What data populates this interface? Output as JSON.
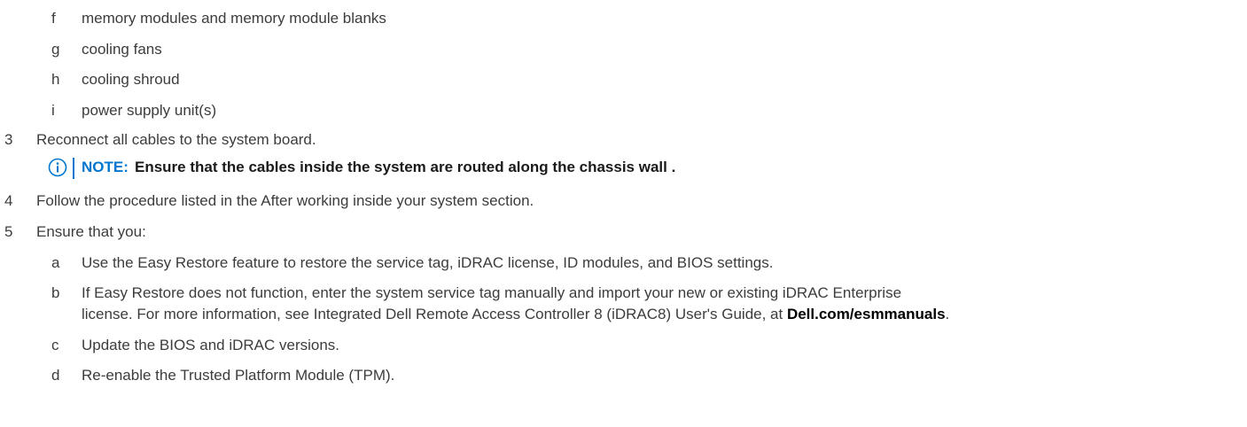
{
  "steps_sub_top": [
    {
      "marker": "f",
      "text": "memory modules and memory module blanks"
    },
    {
      "marker": "g",
      "text": "cooling fans"
    },
    {
      "marker": "h",
      "text": "cooling shroud"
    },
    {
      "marker": "i",
      "text": "power supply unit(s)"
    }
  ],
  "step3": {
    "marker": "3",
    "text": "Reconnect all cables to the system board."
  },
  "note": {
    "label": "NOTE:",
    "text": "Ensure that the cables inside the system are routed along the chassis wall .",
    "icon": "info-circle-icon"
  },
  "step4": {
    "marker": "4",
    "text": "Follow the procedure listed in the After working inside your system section."
  },
  "step5": {
    "marker": "5",
    "text": "Ensure that you:"
  },
  "steps_sub_bottom": {
    "a": {
      "marker": "a",
      "text": "Use the Easy Restore feature to restore the service tag, iDRAC license, ID modules, and BIOS settings."
    },
    "b": {
      "marker": "b",
      "line1": "If Easy Restore does not function, enter the system service tag manually and import your new or existing iDRAC Enterprise",
      "line2_pre": "license. For more information, see Integrated Dell Remote Access Controller 8 (iDRAC8) User's Guide, at ",
      "line2_link": "Dell.com/esmmanuals",
      "line2_post": "."
    },
    "c": {
      "marker": "c",
      "text": "Update the BIOS and iDRAC versions."
    },
    "d": {
      "marker": "d",
      "text": "Re-enable the Trusted Platform Module (TPM)."
    }
  },
  "colors": {
    "accent": "#0076ce",
    "body_text": "#3c3c3c"
  }
}
